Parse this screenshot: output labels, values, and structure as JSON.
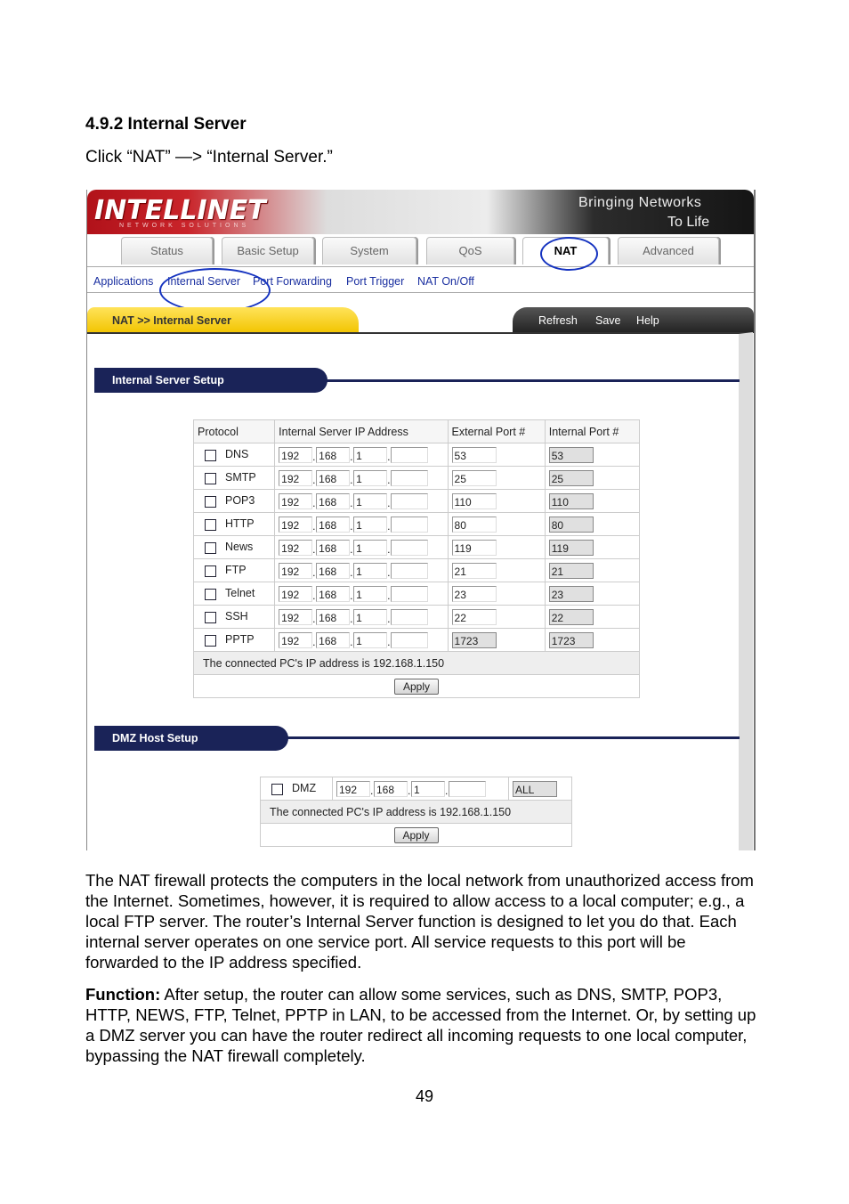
{
  "section_heading": "4.9.2 Internal Server",
  "instruction": "Click “NAT” —> “Internal Server.”",
  "router": {
    "logo": "INTELLINET",
    "logo_sub": "NETWORK SOLUTIONS",
    "slogan_line1": "Bringing Networks",
    "slogan_line2": "To Life",
    "tabs": [
      "Status",
      "Basic Setup",
      "System",
      "QoS",
      "NAT",
      "Advanced"
    ],
    "active_tab": "NAT",
    "subnav": [
      "Applications",
      "Internal Server",
      "Port Forwarding",
      "Port Trigger",
      "NAT On/Off"
    ],
    "breadcrumb": "NAT >> Internal Server",
    "actions": [
      "Refresh",
      "Save",
      "Help"
    ],
    "internal_setup_title": "Internal Server Setup",
    "columns": [
      "Protocol",
      "Internal Server IP Address",
      "External Port #",
      "Internal Port #"
    ],
    "rows": [
      {
        "protocol": "DNS",
        "ip": [
          "192",
          "168",
          "1",
          ""
        ],
        "ext": "53",
        "int": "53",
        "ext_ro": false
      },
      {
        "protocol": "SMTP",
        "ip": [
          "192",
          "168",
          "1",
          ""
        ],
        "ext": "25",
        "int": "25",
        "ext_ro": false
      },
      {
        "protocol": "POP3",
        "ip": [
          "192",
          "168",
          "1",
          ""
        ],
        "ext": "110",
        "int": "110",
        "ext_ro": false
      },
      {
        "protocol": "HTTP",
        "ip": [
          "192",
          "168",
          "1",
          ""
        ],
        "ext": "80",
        "int": "80",
        "ext_ro": false
      },
      {
        "protocol": "News",
        "ip": [
          "192",
          "168",
          "1",
          ""
        ],
        "ext": "119",
        "int": "119",
        "ext_ro": false
      },
      {
        "protocol": "FTP",
        "ip": [
          "192",
          "168",
          "1",
          ""
        ],
        "ext": "21",
        "int": "21",
        "ext_ro": false
      },
      {
        "protocol": "Telnet",
        "ip": [
          "192",
          "168",
          "1",
          ""
        ],
        "ext": "23",
        "int": "23",
        "ext_ro": false
      },
      {
        "protocol": "SSH",
        "ip": [
          "192",
          "168",
          "1",
          ""
        ],
        "ext": "22",
        "int": "22",
        "ext_ro": false
      },
      {
        "protocol": "PPTP",
        "ip": [
          "192",
          "168",
          "1",
          ""
        ],
        "ext": "1723",
        "int": "1723",
        "ext_ro": true
      }
    ],
    "connected_ip_text": "The connected PC's IP address is 192.168.1.150",
    "apply_label": "Apply",
    "dmz_title": "DMZ Host Setup",
    "dmz_label": "DMZ",
    "dmz_ip": [
      "192",
      "168",
      "1",
      ""
    ],
    "dmz_port": "ALL",
    "dmz_connected_text": "The connected PC's IP address is 192.168.1.150",
    "dmz_apply_label": "Apply"
  },
  "paragraph1": "The NAT firewall protects the computers in the local network from unauthorized access from the Internet. Sometimes, however, it is required to allow access to a local computer; e.g., a local FTP server. The router’s Internal Server function is designed to let you do that. Each internal server operates on one service port. All service requests to this port will be forwarded to the IP address specified.",
  "function_label": "Function:",
  "function_text": " After setup, the router can allow some services, such as DNS, SMTP, POP3, HTTP, NEWS, FTP, Telnet, PPTP in LAN, to be accessed from the Internet. Or, by setting up a DMZ server you can have the router redirect all incoming requests to one local computer, bypassing the NAT firewall completely.",
  "page_number": "49"
}
